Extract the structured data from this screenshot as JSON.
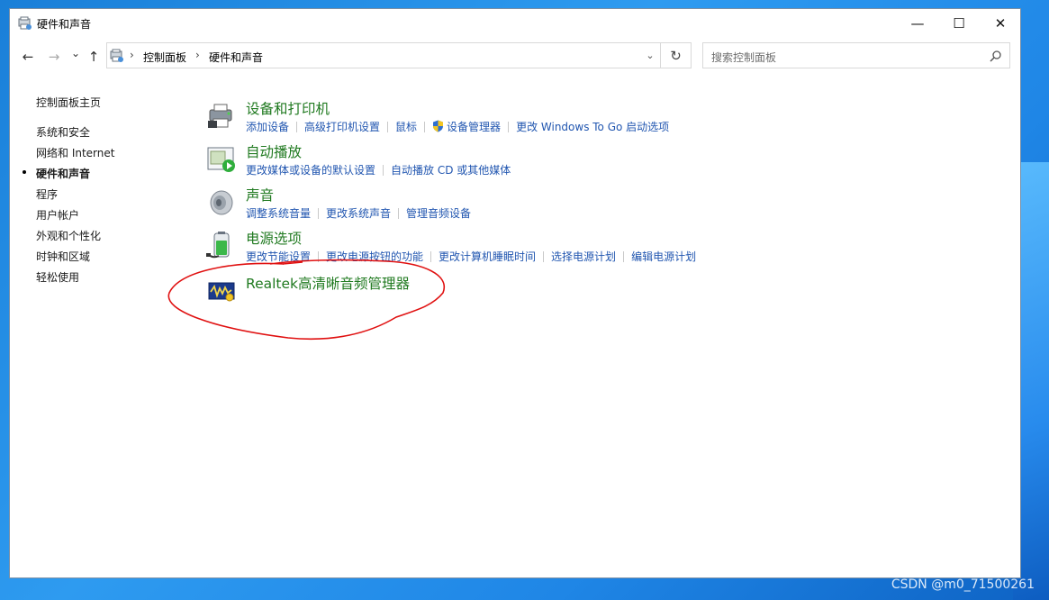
{
  "window": {
    "title": "硬件和声音"
  },
  "controls": {
    "minimize": "—",
    "maximize": "☐",
    "close": "✕"
  },
  "nav": {
    "back": "←",
    "forward": "→",
    "recent": "⌄",
    "up": "↑",
    "refresh": "↻"
  },
  "address": {
    "crumbs": [
      "控制面板",
      "硬件和声音"
    ],
    "sep": "›"
  },
  "search": {
    "placeholder": "搜索控制面板"
  },
  "sidebar": {
    "items": [
      {
        "label": "控制面板主页"
      },
      {
        "label": "系统和安全"
      },
      {
        "label": "网络和 Internet"
      },
      {
        "label": "硬件和声音",
        "active": true
      },
      {
        "label": "程序"
      },
      {
        "label": "用户帐户"
      },
      {
        "label": "外观和个性化"
      },
      {
        "label": "时钟和区域"
      },
      {
        "label": "轻松使用"
      }
    ]
  },
  "categories": [
    {
      "title": "设备和打印机",
      "icon": "printer-icon",
      "links": [
        "添加设备",
        "高级打印机设置",
        "鼠标",
        "设备管理器",
        "更改 Windows To Go 启动选项"
      ]
    },
    {
      "title": "自动播放",
      "icon": "autoplay-icon",
      "links": [
        "更改媒体或设备的默认设置",
        "自动播放 CD 或其他媒体"
      ]
    },
    {
      "title": "声音",
      "icon": "speaker-icon",
      "links": [
        "调整系统音量",
        "更改系统声音",
        "管理音频设备"
      ]
    },
    {
      "title": "电源选项",
      "icon": "battery-icon",
      "links": [
        "更改节能设置",
        "更改电源按钮的功能",
        "更改计算机睡眠时间",
        "选择电源计划",
        "编辑电源计划"
      ]
    },
    {
      "title": "Realtek高清晰音频管理器",
      "icon": "realtek-audio-icon",
      "links": []
    }
  ],
  "colors": {
    "category_title": "#207a20",
    "link": "#2156b0",
    "annotation": "#e01010",
    "desktop": "#1f86e6"
  },
  "watermark": "CSDN @m0_71500261"
}
